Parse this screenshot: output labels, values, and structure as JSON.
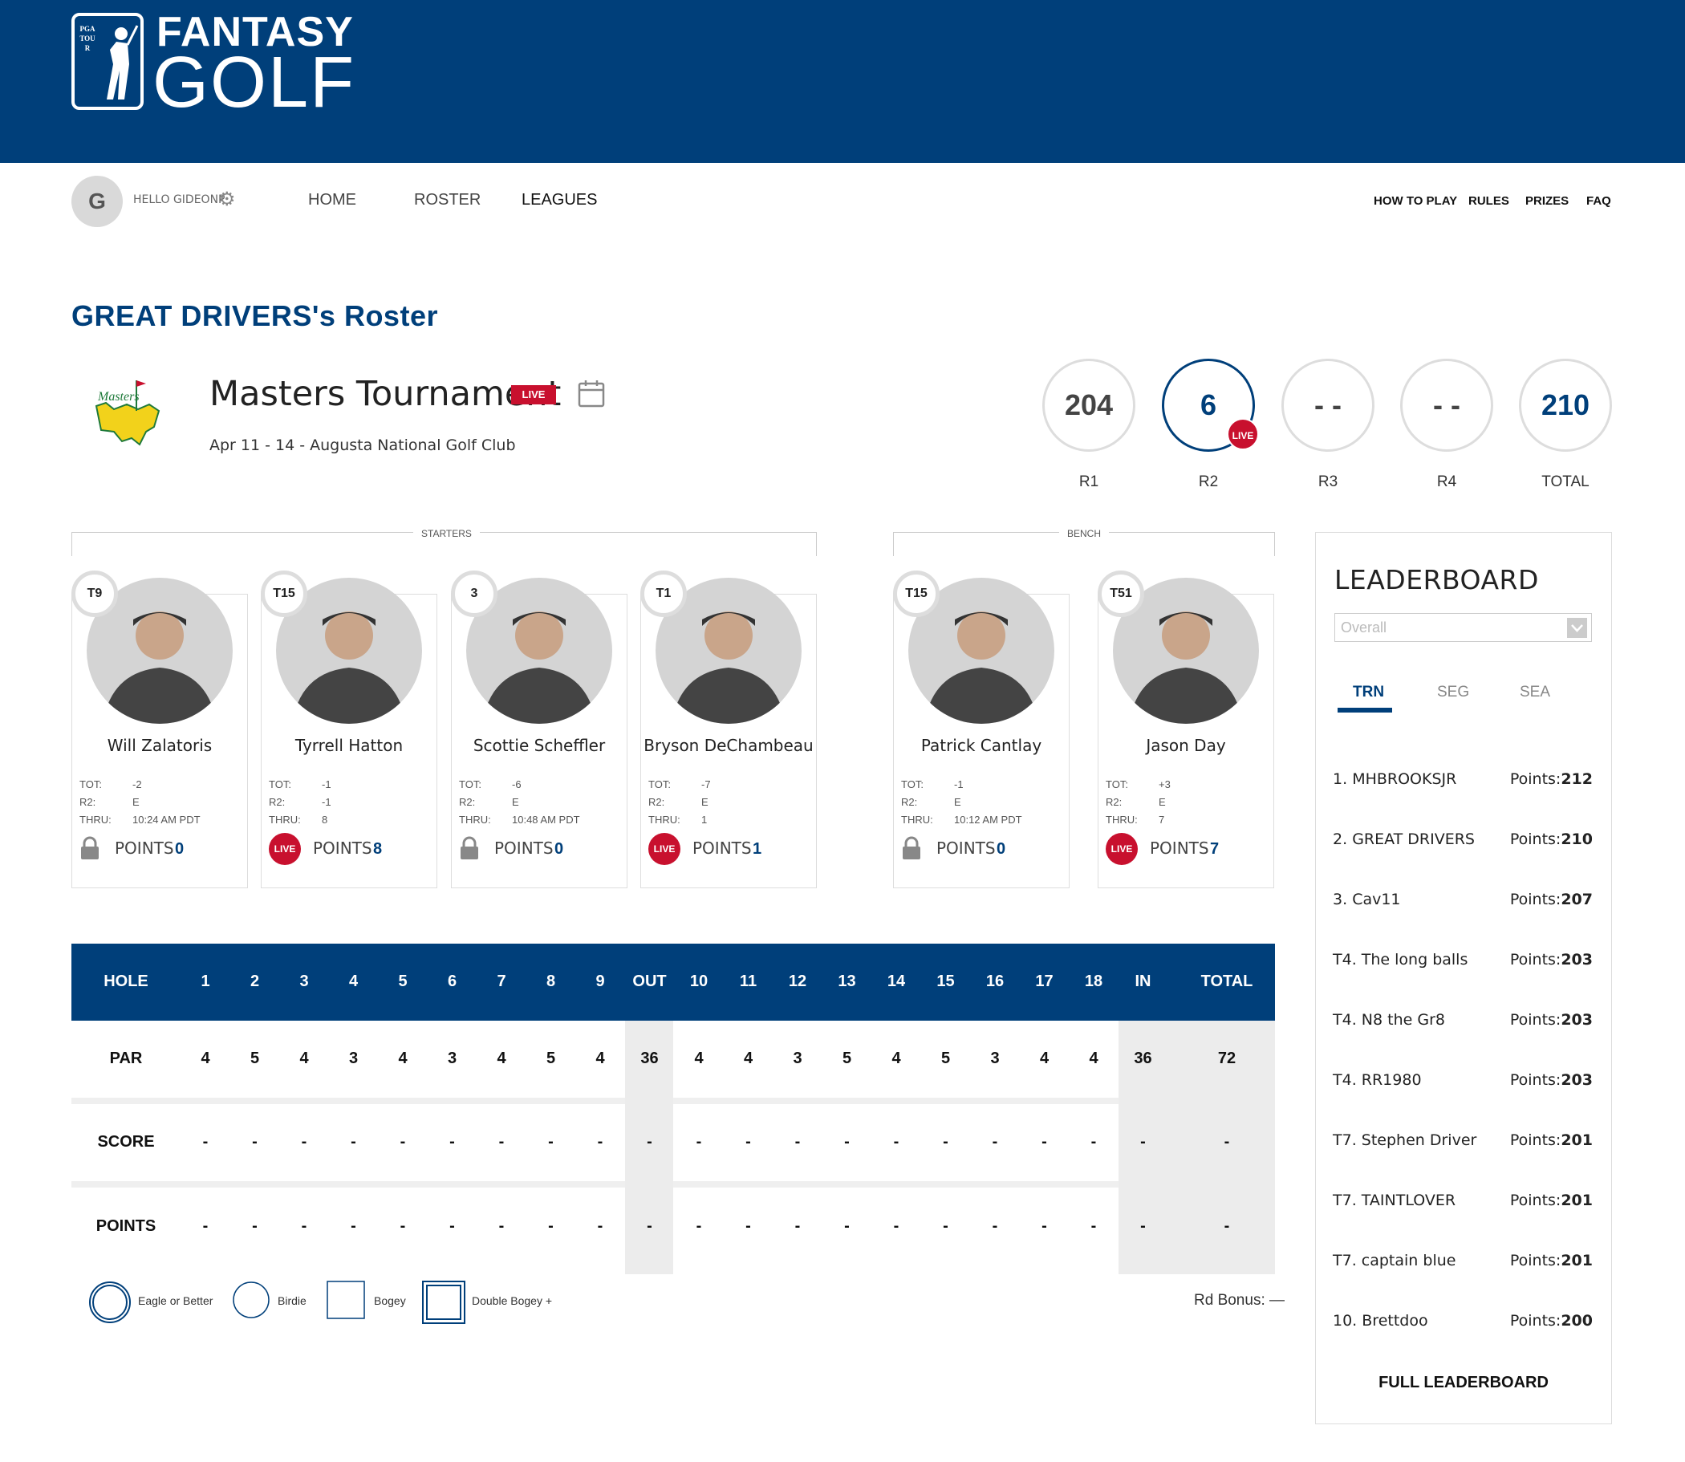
{
  "brand": {
    "logo_small": "PGA TOUR",
    "line1": "FANTASY",
    "line2": "GOLF"
  },
  "user": {
    "initial": "G",
    "greeting": "HELLO GIDEONP"
  },
  "nav": {
    "left": [
      "HOME",
      "ROSTER",
      "LEAGUES"
    ],
    "right": [
      "HOW TO PLAY",
      "RULES",
      "PRIZES",
      "FAQ"
    ]
  },
  "page_title": "GREAT DRIVERS's Roster",
  "tournament": {
    "logo_text": "Masters",
    "name": "Masters Tournament",
    "status": "LIVE",
    "details": "Apr 11 - 14 - Augusta National Golf Club"
  },
  "rounds": [
    {
      "label": "R1",
      "value": "204"
    },
    {
      "label": "R2",
      "value": "6",
      "badge": "LIVE"
    },
    {
      "label": "R3",
      "value": "- -"
    },
    {
      "label": "R4",
      "value": "- -"
    },
    {
      "label": "TOTAL",
      "value": "210"
    }
  ],
  "groups": {
    "starters": "STARTERS",
    "bench": "BENCH"
  },
  "stat_labels": {
    "tot": "TOT:",
    "r2": "R2:",
    "thru": "THRU:",
    "points": "POINTS"
  },
  "players": [
    {
      "pos": "T9",
      "name": "Will Zalatoris",
      "tot": "-2",
      "r2": "E",
      "thru": "10:24 AM PDT",
      "status": "locked",
      "points": "0"
    },
    {
      "pos": "T15",
      "name": "Tyrrell Hatton",
      "tot": "-1",
      "r2": "-1",
      "thru": "8",
      "status": "LIVE",
      "points": "8"
    },
    {
      "pos": "3",
      "name": "Scottie Scheffler",
      "tot": "-6",
      "r2": "E",
      "thru": "10:48 AM PDT",
      "status": "locked",
      "points": "0"
    },
    {
      "pos": "T1",
      "name": "Bryson DeChambeau",
      "tot": "-7",
      "r2": "E",
      "thru": "1",
      "status": "LIVE",
      "points": "1"
    },
    {
      "pos": "T15",
      "name": "Patrick Cantlay",
      "tot": "-1",
      "r2": "E",
      "thru": "10:12 AM PDT",
      "status": "locked",
      "points": "0"
    },
    {
      "pos": "T51",
      "name": "Jason Day",
      "tot": "+3",
      "r2": "E",
      "thru": "7",
      "status": "LIVE",
      "points": "7"
    }
  ],
  "scorecard": {
    "header": [
      "HOLE",
      "1",
      "2",
      "3",
      "4",
      "5",
      "6",
      "7",
      "8",
      "9",
      "OUT",
      "10",
      "11",
      "12",
      "13",
      "14",
      "15",
      "16",
      "17",
      "18",
      "IN",
      "TOTAL"
    ],
    "rows": [
      {
        "label": "PAR",
        "values": [
          "4",
          "5",
          "4",
          "3",
          "4",
          "3",
          "4",
          "5",
          "4",
          "36",
          "4",
          "4",
          "3",
          "5",
          "4",
          "5",
          "3",
          "4",
          "4",
          "36",
          "72"
        ]
      },
      {
        "label": "SCORE",
        "values": [
          "-",
          "-",
          "-",
          "-",
          "-",
          "-",
          "-",
          "-",
          "-",
          "-",
          "-",
          "-",
          "-",
          "-",
          "-",
          "-",
          "-",
          "-",
          "-",
          "-",
          "-"
        ]
      },
      {
        "label": "POINTS",
        "values": [
          "-",
          "-",
          "-",
          "-",
          "-",
          "-",
          "-",
          "-",
          "-",
          "-",
          "-",
          "-",
          "-",
          "-",
          "-",
          "-",
          "-",
          "-",
          "-",
          "-",
          "-"
        ]
      }
    ]
  },
  "legend": [
    "Eagle or Better",
    "Birdie",
    "Bogey",
    "Double Bogey +"
  ],
  "round_bonus": "Rd Bonus: —",
  "leaderboard": {
    "title": "LEADERBOARD",
    "filter_value": "Overall",
    "tabs": [
      "TRN",
      "SEG",
      "SEA"
    ],
    "points_label": "Points:",
    "entries": [
      {
        "rank": "1.",
        "team": "MHBROOKSJR",
        "points": "212"
      },
      {
        "rank": "2.",
        "team": "GREAT DRIVERS",
        "points": "210"
      },
      {
        "rank": "3.",
        "team": "Cav11",
        "points": "207"
      },
      {
        "rank": "T4.",
        "team": "The long balls",
        "points": "203"
      },
      {
        "rank": "T4.",
        "team": "N8 the Gr8",
        "points": "203"
      },
      {
        "rank": "T4.",
        "team": "RR1980",
        "points": "203"
      },
      {
        "rank": "T7.",
        "team": "Stephen Driver",
        "points": "201"
      },
      {
        "rank": "T7.",
        "team": "TAINTLOVER",
        "points": "201"
      },
      {
        "rank": "T7.",
        "team": "captain blue",
        "points": "201"
      },
      {
        "rank": "10.",
        "team": "Brettdoo",
        "points": "200"
      }
    ],
    "full_link": "FULL LEADERBOARD"
  },
  "colors": {
    "brand_blue": "#003f7a",
    "live_red": "#c8102e",
    "masters_yellow": "#f2d21b",
    "masters_green": "#1f7a3a"
  }
}
